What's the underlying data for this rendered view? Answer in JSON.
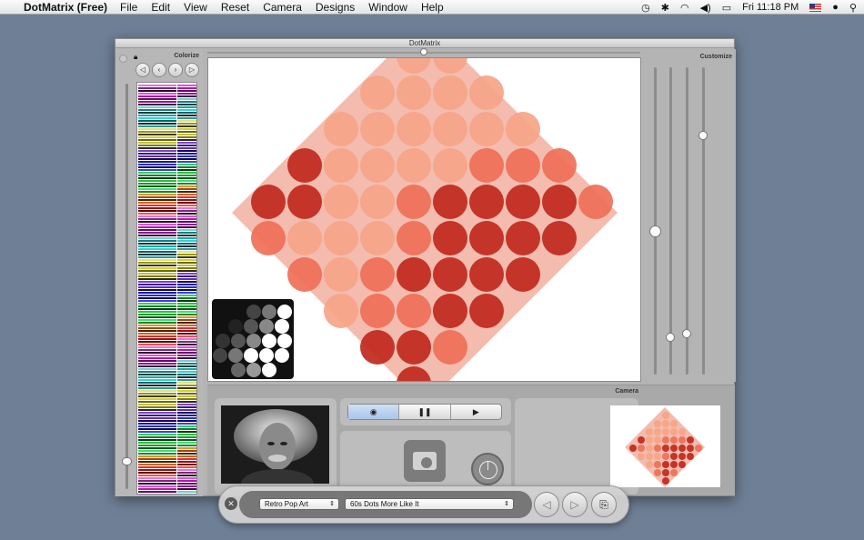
{
  "menubar": {
    "app_name": "DotMatrix (Free)",
    "menus": [
      "File",
      "Edit",
      "View",
      "Reset",
      "Camera",
      "Designs",
      "Window",
      "Help"
    ],
    "clock": "Fri 11:18 PM"
  },
  "window": {
    "title": "DotMatrix",
    "colorize_label": "Colorize",
    "customize_label": "Customize",
    "camera_label": "Camera"
  },
  "camera_controls": {
    "camera_icon": "camera-icon",
    "pause_icon": "pause-icon",
    "play_icon": "play-icon"
  },
  "hud": {
    "preset_category": "Retro Pop Art",
    "preset_design": "60s Dots More Like It"
  },
  "colors": {
    "dot_dark": "#c0281c",
    "dot_light": "#f6a487",
    "dot_mid": "#ef6f57"
  },
  "palette_colors": [
    "#e66fe0",
    "#7b2a7d",
    "#2a0e2b",
    "#e14fdc",
    "#b01aa9",
    "#620f66",
    "#8d1a8a",
    "#3f0940",
    "#6fd0d0",
    "#1e7c7f",
    "#0e3b3b",
    "#17a7a7",
    "#35d0d0",
    "#0f6468",
    "#0a2e33",
    "#2b9898",
    "#e8e170",
    "#9a951c",
    "#3b3a0a",
    "#d4cf2a",
    "#6a680f",
    "#bebf3a",
    "#7f7a10",
    "#2d2c05",
    "#7b3ed8",
    "#3c1a7c",
    "#5b2bd0",
    "#1c0c44",
    "#1616a0",
    "#2a2ad0",
    "#0b0b55",
    "#3c3cf0",
    "#2fd05a",
    "#147a2c",
    "#0a3b16",
    "#27c23f",
    "#1a9a2a",
    "#0c5a18",
    "#3ee070",
    "#0f8a2a",
    "#f08c28",
    "#9a4c0e",
    "#4a2204",
    "#d0641a",
    "#e62a2a",
    "#9e0f0f",
    "#5a0808",
    "#ff4a4a"
  ]
}
